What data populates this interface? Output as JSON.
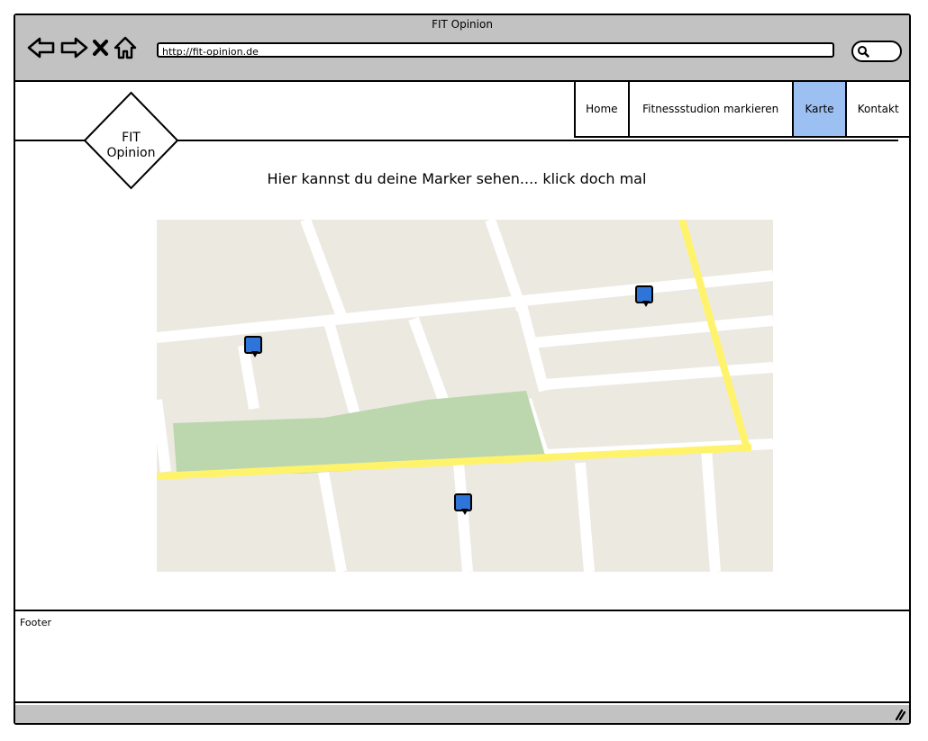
{
  "window": {
    "title": "FIT Opinion"
  },
  "address_bar": {
    "url": "http://fit-opinion.de"
  },
  "logo": {
    "text": "FIT\nOpinion"
  },
  "nav": {
    "items": [
      {
        "label": "Home",
        "active": false
      },
      {
        "label": "Fitnessstudion markieren",
        "active": false
      },
      {
        "label": "Karte",
        "active": true
      },
      {
        "label": "Kontakt",
        "active": false
      }
    ]
  },
  "main": {
    "headline": "Hier kannst du deine Marker sehen.... klick doch mal"
  },
  "map": {
    "markers_count": 3,
    "marker_color": "#2f74d9",
    "park_color": "#bcd6ad",
    "highway_color": "#fff36b"
  },
  "footer": {
    "label": "Footer"
  },
  "colors": {
    "chrome": "#c2c2c2",
    "active_nav": "#9dc0f2"
  }
}
